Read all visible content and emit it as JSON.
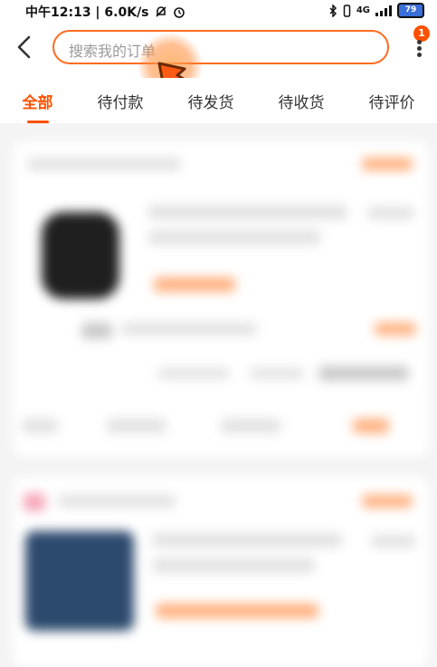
{
  "status_bar": {
    "time_speed": "中午12:13 | 6.0K/s",
    "signal_text": "4G",
    "battery_level": "79"
  },
  "header": {
    "search_placeholder": "搜索我的订单",
    "notification_count": "1"
  },
  "tabs": [
    {
      "label": "全部",
      "active": true
    },
    {
      "label": "待付款",
      "active": false
    },
    {
      "label": "待发货",
      "active": false
    },
    {
      "label": "待收货",
      "active": false
    },
    {
      "label": "待评价",
      "active": false
    }
  ],
  "colors": {
    "accent": "#ff5000",
    "search_border": "#ff6a1f",
    "background": "#f4f4f4"
  },
  "icons": {
    "back": "chevron-left-icon",
    "more": "vertical-ellipsis-icon",
    "cursor": "pointer-arrow-icon"
  }
}
